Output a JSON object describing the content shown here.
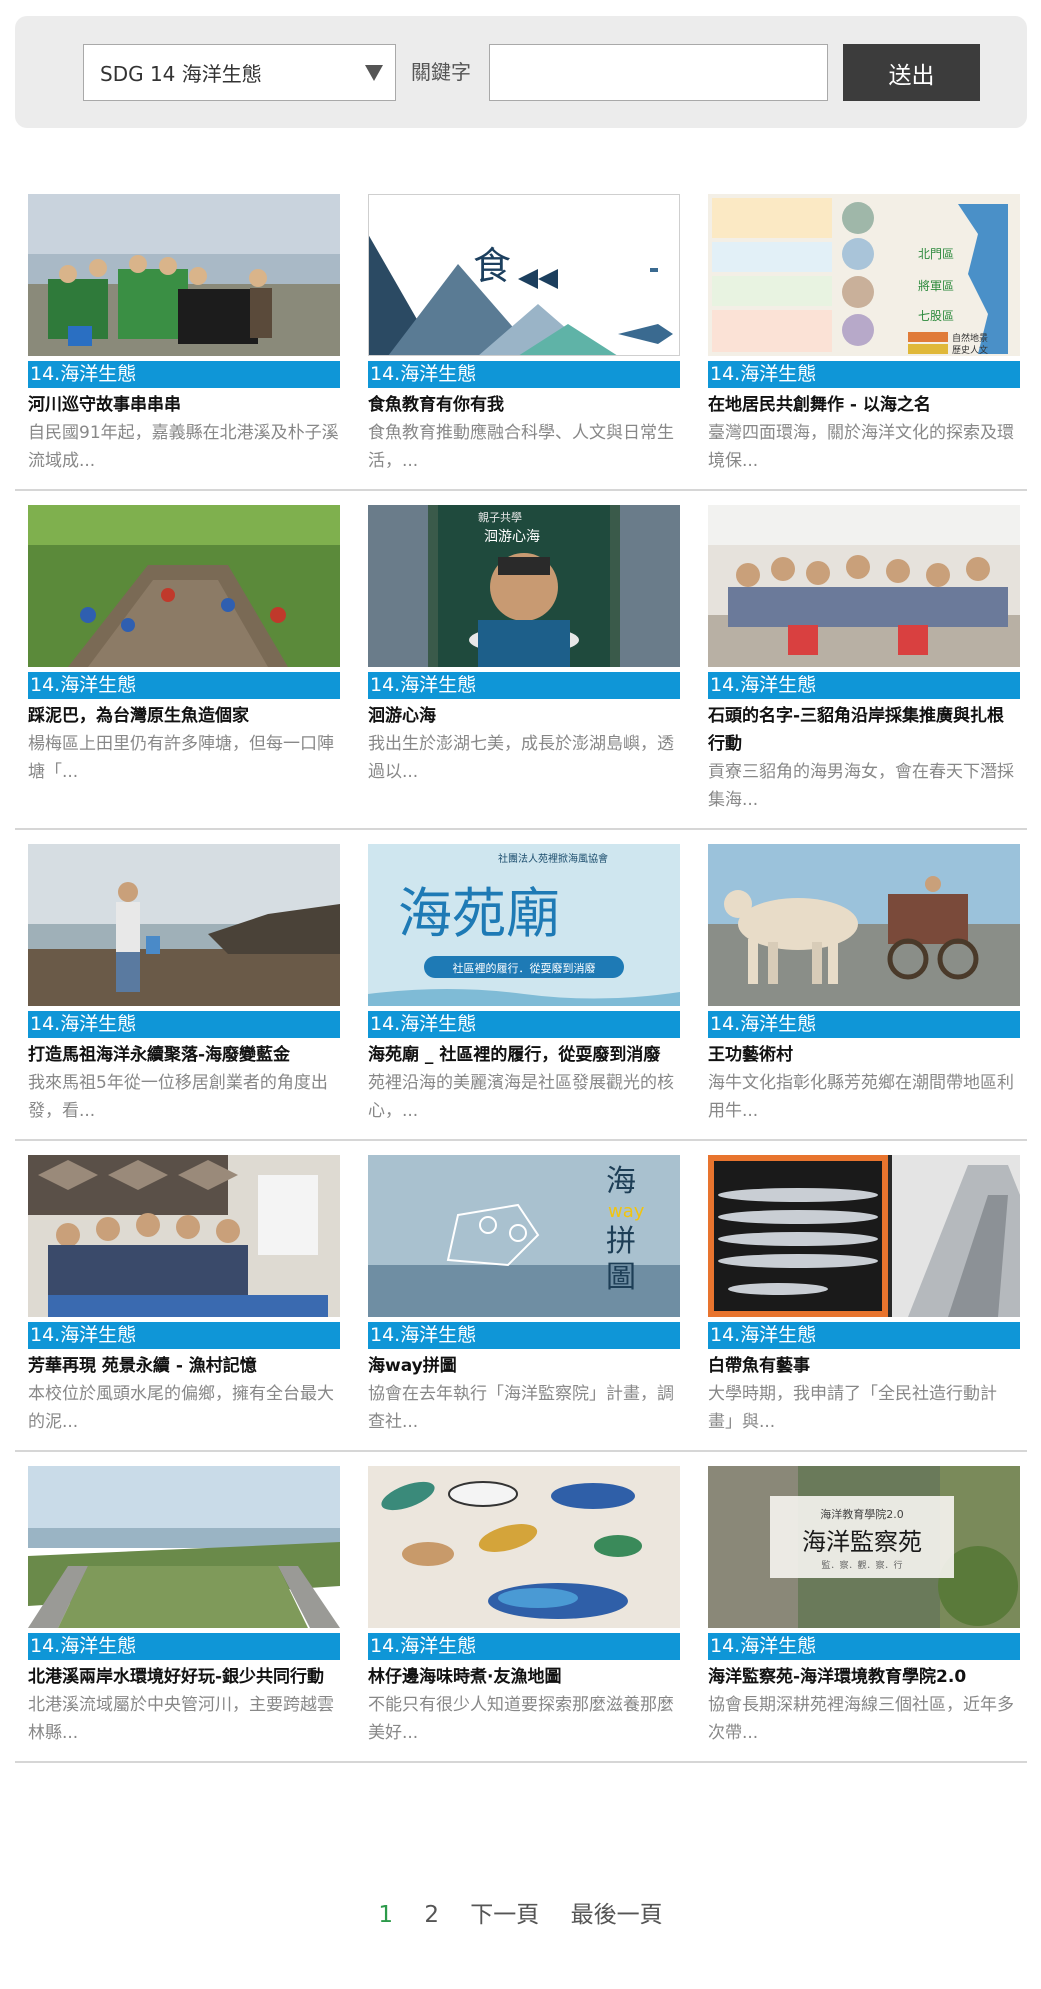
{
  "search": {
    "sdg_selected": "SDG 14 海洋生態",
    "keyword_label": "關鍵字",
    "keyword_value": "",
    "keyword_placeholder": "",
    "submit_label": "送出"
  },
  "cards": [
    {
      "tag": "14.海洋生態",
      "title": "河川巡守故事串串串",
      "desc": "自民國91年起，嘉義縣在北港溪及朴子溪流域成..."
    },
    {
      "tag": "14.海洋生態",
      "title": "食魚教育有你有我",
      "desc": "食魚教育推動應融合科學、人文與日常生活，..."
    },
    {
      "tag": "14.海洋生態",
      "title": "在地居民共創舞作 - 以海之名",
      "desc": "臺灣四面環海，關於海洋文化的探索及環境保..."
    },
    {
      "tag": "14.海洋生態",
      "title": "踩泥巴，為台灣原生魚造個家",
      "desc": "楊梅區上田里仍有許多陣塘，但每一口陣塘「..."
    },
    {
      "tag": "14.海洋生態",
      "title": "洄游心海",
      "desc": "我出生於澎湖七美，成長於澎湖島嶼，透過以..."
    },
    {
      "tag": "14.海洋生態",
      "title": "石頭的名字-三貂角沿岸採集推廣與扎根行動",
      "desc": "貢寮三貂角的海男海女，會在春天下潛採集海..."
    },
    {
      "tag": "14.海洋生態",
      "title": "打造馬祖海洋永續聚落-海廢變藍金",
      "desc": "我來馬祖5年從一位移居創業者的角度出發，看..."
    },
    {
      "tag": "14.海洋生態",
      "title": "海苑廟 _ 社區裡的履行，從耍廢到消廢",
      "desc": "苑裡沿海的美麗濱海是社區發展觀光的核心，..."
    },
    {
      "tag": "14.海洋生態",
      "title": "王功藝術村",
      "desc": "海牛文化指彰化縣芳苑鄉在潮間帶地區利用牛..."
    },
    {
      "tag": "14.海洋生態",
      "title": "芳華再現 苑景永續 - 漁村記憶",
      "desc": "本校位於風頭水尾的偏鄉，擁有全台最大的泥..."
    },
    {
      "tag": "14.海洋生態",
      "title": "海way拼圖",
      "desc": "協會在去年執行「海洋監察院」計畫，調查社..."
    },
    {
      "tag": "14.海洋生態",
      "title": "白帶魚有藝事",
      "desc": "大學時期，我申請了「全民社造行動計畫」與..."
    },
    {
      "tag": "14.海洋生態",
      "title": "北港溪兩岸水環境好好玩-銀少共同行動",
      "desc": "北港溪流域屬於中央管河川，主要跨越雲林縣..."
    },
    {
      "tag": "14.海洋生態",
      "title": "林仔邊海味時煮·友漁地圖",
      "desc": "不能只有很少人知道要探索那麼滋養那麼美好..."
    },
    {
      "tag": "14.海洋生態",
      "title": "海洋監察苑-海洋環境教育學院2.0",
      "desc": "協會長期深耕苑裡海線三個社區，近年多次帶..."
    }
  ],
  "thumb_text": {
    "t2": "食",
    "t5_top": "親子共學",
    "t5_title": "洄游心海",
    "t8_title": "海苑廟",
    "t8_sub": "社區裡的履行．從耍廢到消廢",
    "t8_org": "社團法人苑裡掀海風協會",
    "t11_a": "海",
    "t11_b": "way",
    "t11_c": "拼",
    "t11_d": "圖",
    "t15_top": "海洋教育學院2.0",
    "t15_title": "海洋監察苑",
    "t15_sub": "監．察．觀．察．行",
    "t3_labels": [
      "北門區",
      "將軍區",
      "七股區"
    ],
    "t3_legend": [
      "自然地景",
      "歷史人文"
    ]
  },
  "pagination": {
    "page1": "1",
    "page2": "2",
    "next": "下一頁",
    "last": "最後一頁"
  },
  "colors": {
    "tag_bg": "#0f96d7",
    "current_page": "#2c9a4a",
    "submit_bg": "#3c3c3c"
  }
}
